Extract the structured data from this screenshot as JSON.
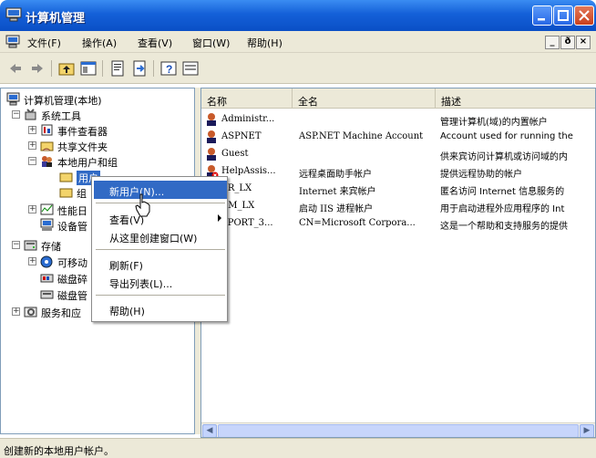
{
  "window": {
    "title": "计算机管理"
  },
  "menubar": {
    "items": [
      {
        "label": "文件(F)"
      },
      {
        "label": "操作(A)"
      },
      {
        "label": "查看(V)"
      },
      {
        "label": "窗口(W)"
      },
      {
        "label": "帮助(H)"
      }
    ],
    "mdi": [
      "_",
      "ð",
      "×"
    ]
  },
  "toolbar": {
    "buttons": [
      "back-arrow-icon",
      "forward-arrow-icon",
      "up-folder-icon",
      "show-tree-icon",
      "properties-icon",
      "export-icon",
      "help-icon",
      "console-icon"
    ]
  },
  "tree": {
    "nodes": [
      {
        "label": "计算机管理(本地)"
      },
      {
        "label": "系统工具"
      },
      {
        "label": "事件查看器"
      },
      {
        "label": "共享文件夹"
      },
      {
        "label": "本地用户和组"
      },
      {
        "label": "用户"
      },
      {
        "label": "组"
      },
      {
        "label": "性能日"
      },
      {
        "label": "设备管"
      },
      {
        "label": "存储"
      },
      {
        "label": "可移动"
      },
      {
        "label": "磁盘碎"
      },
      {
        "label": "磁盘管"
      },
      {
        "label": "服务和应"
      }
    ]
  },
  "list": {
    "headers": [
      "名称",
      "全名",
      "描述"
    ],
    "rows": [
      {
        "name": "Administr...",
        "fullname": "",
        "desc": "管理计算机(域)的内置帐户"
      },
      {
        "name": "ASPNET",
        "fullname": "ASP.NET Machine Account",
        "desc": "Account used for running the"
      },
      {
        "name": "Guest",
        "fullname": "",
        "desc": "供来宾访问计算机或访问域的内"
      },
      {
        "name": "HelpAssis...",
        "fullname": "远程桌面助手帐户",
        "desc": "提供远程协助的帐户"
      },
      {
        "name": "SR_LX",
        "fullname": "Internet 来宾帐户",
        "desc": "匿名访问 Internet 信息服务的"
      },
      {
        "name": "AM_LX",
        "fullname": "启动 IIS 进程帐户",
        "desc": "用于启动进程外应用程序的 Int"
      },
      {
        "name": "PPORT_3...",
        "fullname": "CN=Microsoft Corpora...",
        "desc": "这是一个帮助和支持服务的提供"
      }
    ]
  },
  "context_menu": {
    "items": [
      {
        "label": "新用户(N)..."
      },
      {
        "label": "查看(V)"
      },
      {
        "label": "从这里创建窗口(W)"
      },
      {
        "label": "刷新(F)"
      },
      {
        "label": "导出列表(L)..."
      },
      {
        "label": "帮助(H)"
      }
    ]
  },
  "status": {
    "text": "创建新的本地用户帐户。"
  },
  "colors": {
    "titlebar": "#0a4fc6",
    "highlight": "#316ac5",
    "chrome": "#ece9d8"
  }
}
